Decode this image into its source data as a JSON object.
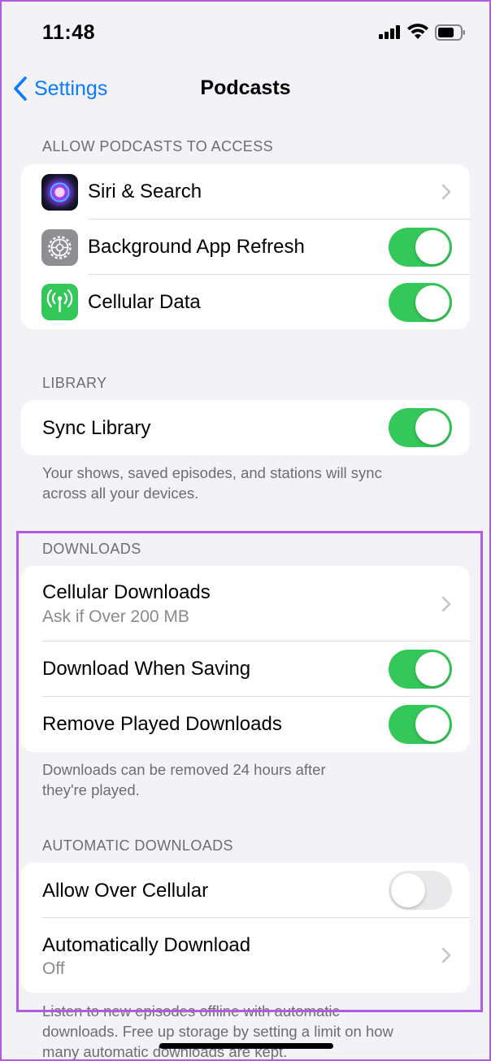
{
  "status_bar": {
    "time": "11:48"
  },
  "nav": {
    "back_label": "Settings",
    "title": "Podcasts"
  },
  "access": {
    "header": "ALLOW PODCASTS TO ACCESS",
    "items": [
      {
        "label": "Siri & Search",
        "icon": "siri-icon",
        "accessory": "chevron"
      },
      {
        "label": "Background App Refresh",
        "icon": "gear-icon",
        "accessory": "toggle",
        "on": true
      },
      {
        "label": "Cellular Data",
        "icon": "antenna-icon",
        "accessory": "toggle",
        "on": true
      }
    ]
  },
  "library": {
    "header": "LIBRARY",
    "sync_label": "Sync Library",
    "sync_on": true,
    "footer_line1": "Your shows, saved episodes, and stations will sync",
    "footer_line2": "across all your devices."
  },
  "downloads": {
    "header": "DOWNLOADS",
    "cellular_label": "Cellular Downloads",
    "cellular_value": "Ask if Over 200 MB",
    "when_saving_label": "Download When Saving",
    "when_saving_on": true,
    "remove_played_label": "Remove Played Downloads",
    "remove_played_on": true,
    "footer_line1": "Downloads can be removed 24 hours after",
    "footer_line2": "they're played."
  },
  "automatic": {
    "header": "AUTOMATIC DOWNLOADS",
    "allow_cellular_label": "Allow Over Cellular",
    "allow_cellular_on": false,
    "auto_download_label": "Automatically Download",
    "auto_download_value": "Off",
    "footer_line1": "Listen to new episodes offline with automatic",
    "footer_line2": "downloads. Free up storage by setting a limit on how",
    "footer_line3": "many automatic downloads are kept."
  },
  "colors": {
    "accent": "#0a7aff",
    "toggle_on": "#34c759",
    "highlight": "#b35be0"
  }
}
